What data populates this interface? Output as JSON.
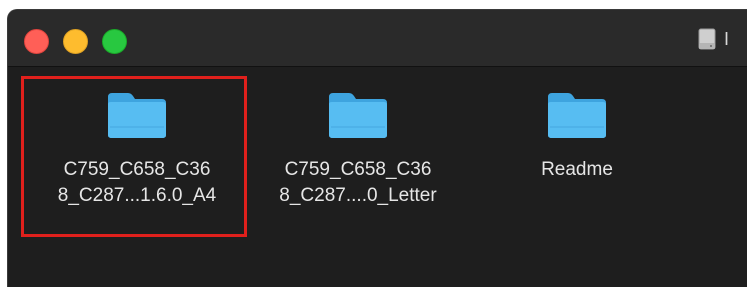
{
  "window": {
    "title": "I"
  },
  "items": [
    {
      "line1": "C759_C658_C36",
      "line2": "8_C287...1.6.0_A4",
      "selected": true
    },
    {
      "line1": "C759_C658_C36",
      "line2": "8_C287....0_Letter",
      "selected": false
    },
    {
      "line1": "Readme",
      "line2": "",
      "selected": false
    }
  ],
  "colors": {
    "folder": "#4fb6ef",
    "folder_tab": "#3ea4df",
    "selection": "#e0201c",
    "background": "#1e1e1e"
  },
  "icons": {
    "folder": "folder-icon",
    "disk": "disk-icon"
  }
}
